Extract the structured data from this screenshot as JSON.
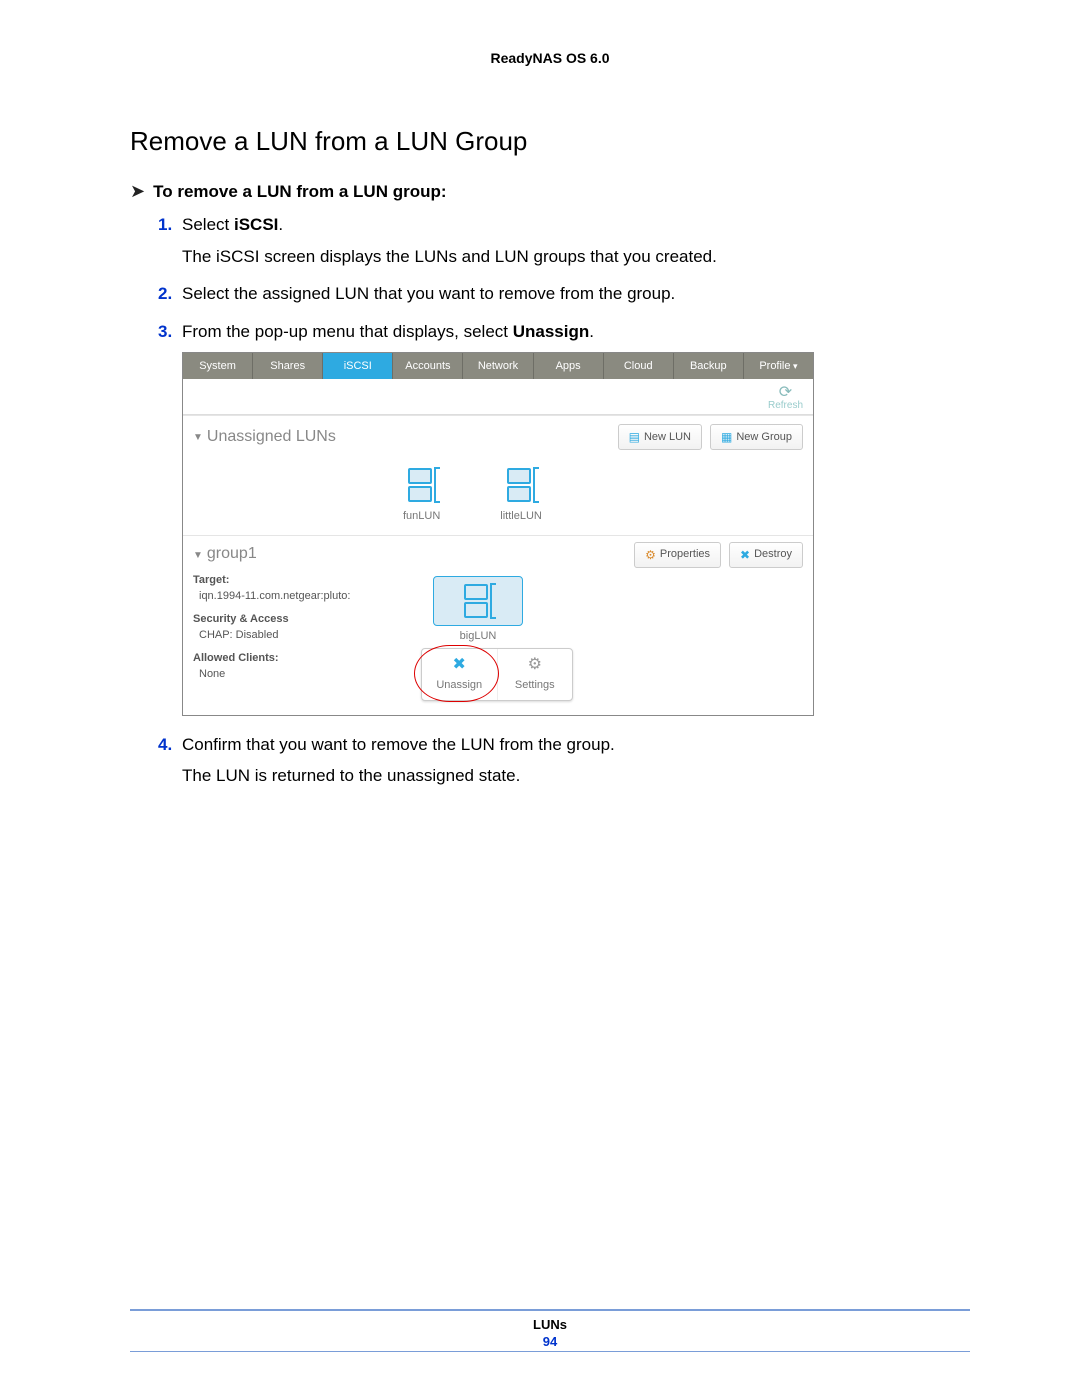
{
  "header": {
    "product": "ReadyNAS OS 6.0"
  },
  "section": {
    "title": "Remove a LUN from a LUN Group"
  },
  "procedure": {
    "intro": "To remove a LUN from a LUN group:"
  },
  "steps": [
    {
      "num": "1.",
      "prefix": "Select ",
      "bold": "iSCSI",
      "suffix": ".",
      "after": "The iSCSI screen displays the LUNs and LUN groups that you created."
    },
    {
      "num": "2.",
      "text": "Select the assigned LUN that you want to remove from the group."
    },
    {
      "num": "3.",
      "prefix": "From the pop-up menu that displays, select ",
      "bold": "Unassign",
      "suffix": "."
    },
    {
      "num": "4.",
      "text": "Confirm that you want to remove the LUN from the group.",
      "after": "The LUN is returned to the unassigned state."
    }
  ],
  "shot": {
    "tabs": [
      "System",
      "Shares",
      "iSCSI",
      "Accounts",
      "Network",
      "Apps",
      "Cloud",
      "Backup",
      "Profile"
    ],
    "activeTab": "iSCSI",
    "refresh": "Refresh",
    "unassigned": {
      "title": "Unassigned LUNs",
      "newLun": "New LUN",
      "newGroup": "New Group",
      "luns": [
        "funLUN",
        "littleLUN"
      ]
    },
    "group": {
      "name": "group1",
      "properties": "Properties",
      "destroy": "Destroy",
      "targetLabel": "Target:",
      "targetVal": "iqn.1994-11.com.netgear:pluto:",
      "secLabel": "Security & Access",
      "secVal": "CHAP: Disabled",
      "clientsLabel": "Allowed Clients:",
      "clientsVal": "None",
      "lun": "bigLUN",
      "popup": {
        "unassign": "Unassign",
        "settings": "Settings"
      }
    }
  },
  "footer": {
    "section": "LUNs",
    "page": "94"
  }
}
